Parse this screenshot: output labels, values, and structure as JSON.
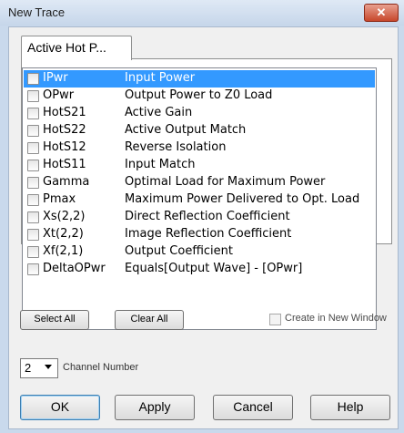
{
  "window": {
    "title": "New Trace",
    "close_glyph": "✕"
  },
  "tabs": [
    {
      "label": "Active Hot P...",
      "active": true
    }
  ],
  "trace_list": {
    "items": [
      {
        "name": "IPwr",
        "description": "Input Power",
        "checked": false,
        "selected": true
      },
      {
        "name": "OPwr",
        "description": "Output Power to Z0 Load",
        "checked": false,
        "selected": false
      },
      {
        "name": "HotS21",
        "description": "Active Gain",
        "checked": false,
        "selected": false
      },
      {
        "name": "HotS22",
        "description": "Active Output Match",
        "checked": false,
        "selected": false
      },
      {
        "name": "HotS12",
        "description": "Reverse Isolation",
        "checked": false,
        "selected": false
      },
      {
        "name": "HotS11",
        "description": "Input Match",
        "checked": false,
        "selected": false
      },
      {
        "name": "Gamma",
        "description": "Optimal Load for Maximum Power",
        "checked": false,
        "selected": false
      },
      {
        "name": "Pmax",
        "description": "Maximum Power Delivered to Opt. Load",
        "checked": false,
        "selected": false
      },
      {
        "name": "Xs(2,2)",
        "description": "Direct Reflection Coefficient",
        "checked": false,
        "selected": false
      },
      {
        "name": "Xt(2,2)",
        "description": "Image Reflection Coefficient",
        "checked": false,
        "selected": false
      },
      {
        "name": "Xf(2,1)",
        "description": "Output Coefficient",
        "checked": false,
        "selected": false
      },
      {
        "name": "DeltaOPwr",
        "description": "Equals[Output Wave] - [OPwr]",
        "checked": false,
        "selected": false
      }
    ]
  },
  "actions": {
    "select_all": "Select All",
    "clear_all": "Clear All",
    "create_in_new_window": {
      "label": "Create in New Window",
      "checked": false
    }
  },
  "channel": {
    "value": "2",
    "label": "Channel Number"
  },
  "footer": {
    "ok": "OK",
    "apply": "Apply",
    "cancel": "Cancel",
    "help": "Help"
  },
  "colors": {
    "selection": "#3399ff",
    "dialog_face": "#f0f0f0",
    "title_bar": "#c9d9ec",
    "close_button": "#c7472b"
  }
}
